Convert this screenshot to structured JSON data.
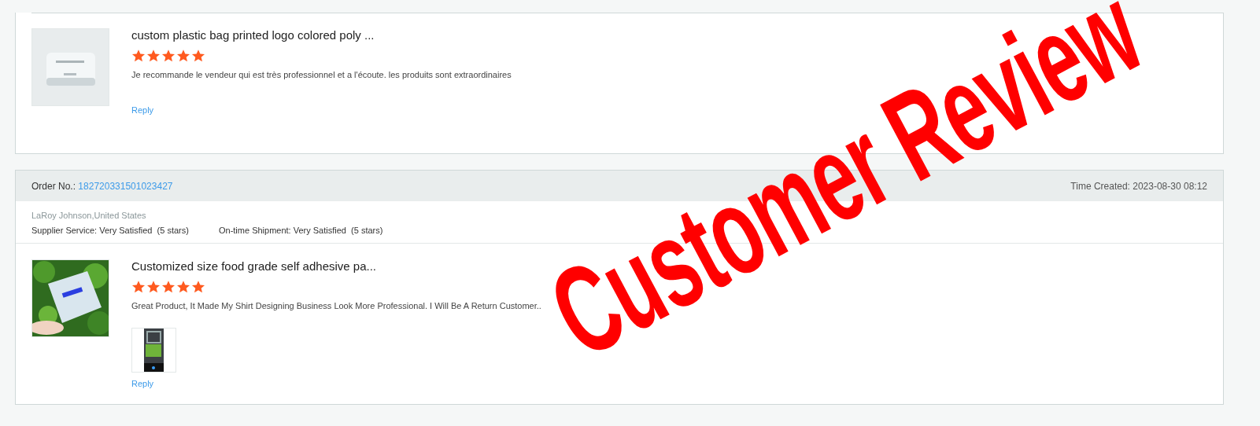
{
  "reviews": [
    {
      "product": {
        "title": "custom plastic bag printed logo colored poly ...",
        "stars": 5,
        "comment": "Je recommande le vendeur qui est très professionnel et a l'écoute. les produits sont extraordinaires",
        "reply": "Reply"
      }
    },
    {
      "order": {
        "label": "Order No.:",
        "number": "182720331501023427",
        "time": "Time Created: 2023-08-30 08:12",
        "buyer": "LaRoy Johnson,United States",
        "ratings": [
          {
            "label": "Supplier Service:",
            "value": "Very Satisfied",
            "count": "(5 stars)"
          },
          {
            "label": "On-time Shipment:",
            "value": "Very Satisfied",
            "count": "(5 stars)"
          }
        ]
      },
      "product": {
        "title": "Customized size food grade self adhesive pa...",
        "stars": 5,
        "comment": "Great Product, It Made My Shirt Designing Business Look More Professional. I Will Be A Return Customer..",
        "attachments": [
          {
            "kind": "picture"
          }
        ],
        "reply": "Reply"
      }
    }
  ],
  "overlay": {
    "text": "Customer Review"
  }
}
